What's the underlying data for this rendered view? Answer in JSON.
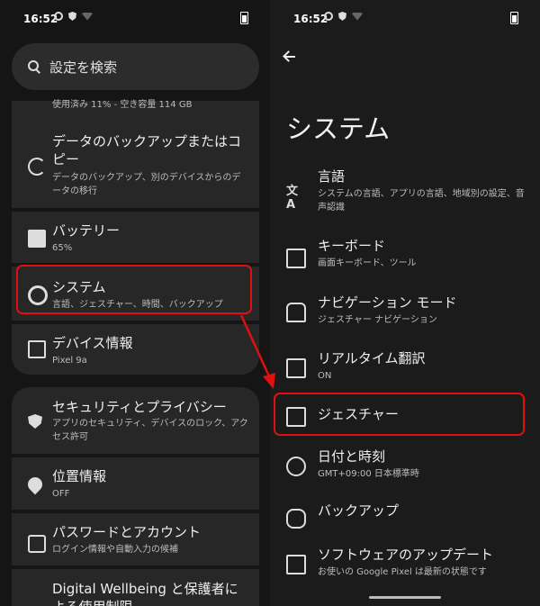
{
  "status_bar": {
    "time": "16:52"
  },
  "left": {
    "search": {
      "placeholder": "設定を検索"
    },
    "storage_partial": "使用済み 11% - 空き容量 114 GB",
    "items": [
      {
        "title": "データのバックアップまたはコピー",
        "subtitle": "データのバックアップ、別のデバイスからのデータの移行"
      },
      {
        "title": "バッテリー",
        "subtitle": "65%"
      },
      {
        "title": "システム",
        "subtitle": "言語、ジェスチャー、時間、バックアップ"
      },
      {
        "title": "デバイス情報",
        "subtitle": "Pixel 9a"
      },
      {
        "title": "セキュリティとプライバシー",
        "subtitle": "アプリのセキュリティ、デバイスのロック、アクセス許可"
      },
      {
        "title": "位置情報",
        "subtitle": "OFF"
      },
      {
        "title": "パスワードとアカウント",
        "subtitle": "ログイン情報や自動入力の候補"
      },
      {
        "title": "Digital Wellbeing と保護者による使用制限",
        "subtitle": ""
      }
    ]
  },
  "right": {
    "title": "システム",
    "items": [
      {
        "title": "言語",
        "subtitle": "システムの言語、アプリの言語、地域別の設定、音声認識",
        "icon": "translate-language-icon"
      },
      {
        "title": "キーボード",
        "subtitle": "画面キーボード、ツール",
        "icon": "keyboard-icon"
      },
      {
        "title": "ナビゲーション モード",
        "subtitle": "ジェスチャー ナビゲーション",
        "icon": "hand-gesture-icon"
      },
      {
        "title": "リアルタイム翻訳",
        "subtitle": "ON",
        "icon": "live-translate-icon"
      },
      {
        "title": "ジェスチャー",
        "subtitle": "",
        "icon": "phone-gesture-icon"
      },
      {
        "title": "日付と時刻",
        "subtitle": "GMT+09:00 日本標準時",
        "icon": "clock-icon"
      },
      {
        "title": "バックアップ",
        "subtitle": "",
        "icon": "cloud-upload-icon"
      },
      {
        "title": "ソフトウェアのアップデート",
        "subtitle": "お使いの Google Pixel は最新の状態です",
        "icon": "system-update-icon"
      }
    ]
  },
  "colors": {
    "highlight": "#e01010",
    "background": "#1b1b1b",
    "card": "#272727"
  }
}
